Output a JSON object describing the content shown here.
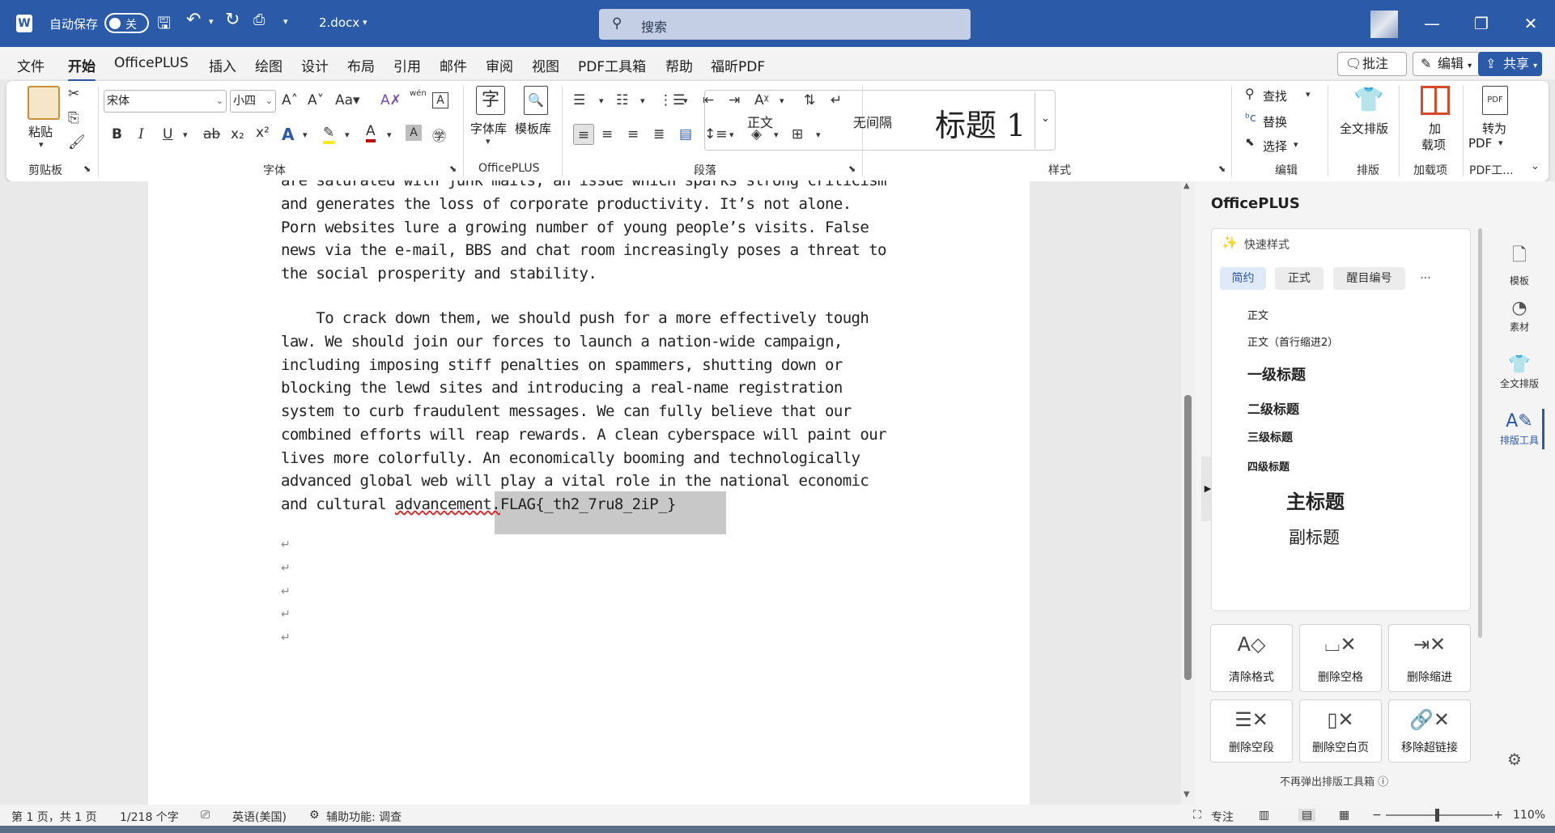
{
  "titlebar": {
    "autosave_label": "自动保存",
    "autosave_state": "关",
    "filename": "2.docx",
    "search_placeholder": "搜索"
  },
  "menu": {
    "tabs": [
      "文件",
      "开始",
      "OfficePLUS",
      "插入",
      "绘图",
      "设计",
      "布局",
      "引用",
      "邮件",
      "审阅",
      "视图",
      "PDF工具箱",
      "帮助",
      "福昕PDF"
    ],
    "active_tab": "开始",
    "comment_label": "批注",
    "edit_label": "编辑",
    "share_label": "共享"
  },
  "ribbon": {
    "clipboard": {
      "paste": "粘贴",
      "group": "剪贴板"
    },
    "font": {
      "name": "宋体",
      "size": "小四",
      "group": "字体",
      "wen": "wén"
    },
    "officeplus": {
      "fontlib": "字体库",
      "templatelib": "模板库",
      "group": "OfficePLUS"
    },
    "paragraph": {
      "group": "段落"
    },
    "styles": {
      "items": [
        "正文",
        "无间隔",
        "标题 1"
      ],
      "group": "样式"
    },
    "editing": {
      "find": "查找",
      "replace": "替换",
      "select": "选择",
      "group": "编辑"
    },
    "layout": {
      "full": "全文排版",
      "group": "排版"
    },
    "addins": {
      "label1": "加",
      "label2": "载项",
      "group": "加载项"
    },
    "pdf": {
      "label1": "转为",
      "label2": "PDF",
      "group": "PDF工..."
    }
  },
  "document": {
    "lines": [
      "are saturated with junk mails, an issue which sparks strong criticism",
      "and generates the loss of corporate productivity. It’s not alone.",
      "Porn websites lure a growing number of young people’s visits. False",
      "news via the e-mail, BBS and chat room increasingly poses a threat to",
      "the social prosperity and stability.",
      "",
      "    To crack down them, we should push for a more effectively tough",
      "law. We should join our forces to launch a nation-wide campaign,",
      "including imposing stiff penalties on spammers, shutting down or",
      "blocking the lewd sites and introducing a real-name registration",
      "system to curb fraudulent messages. We can fully believe that our",
      "combined efforts will reap rewards. A clean cyberspace will paint our",
      "lives more colorfully. An economically booming and technologically",
      "advanced global web will play a vital role in the national economic"
    ],
    "last_line_prefix": "and cultural ",
    "last_line_word": "advancement.",
    "flag_text": "FLAG{_th2_7ru8_2iP_}",
    "para_mark": "↵"
  },
  "panel": {
    "title": "OfficePLUS",
    "quick_style": "快速样式",
    "chips": [
      "简约",
      "正式",
      "醒目编号",
      "···"
    ],
    "styles": [
      "正文",
      "正文（首行缩进2）",
      "一级标题",
      "二级标题",
      "三级标题",
      "四级标题",
      "主标题",
      "副标题"
    ],
    "tools": [
      "清除格式",
      "删除空格",
      "删除缩进",
      "删除空段",
      "删除空白页",
      "移除超链接"
    ],
    "footer": "不再弹出排版工具箱 ⓘ"
  },
  "rail": [
    "模板",
    "素材",
    "全文排版",
    "排版工具"
  ],
  "status": {
    "page": "第 1 页，共 1 页",
    "words": "1/218 个字",
    "language": "英语(美国)",
    "accessibility": "辅助功能: 调查",
    "focus": "专注",
    "zoom": "110%"
  }
}
